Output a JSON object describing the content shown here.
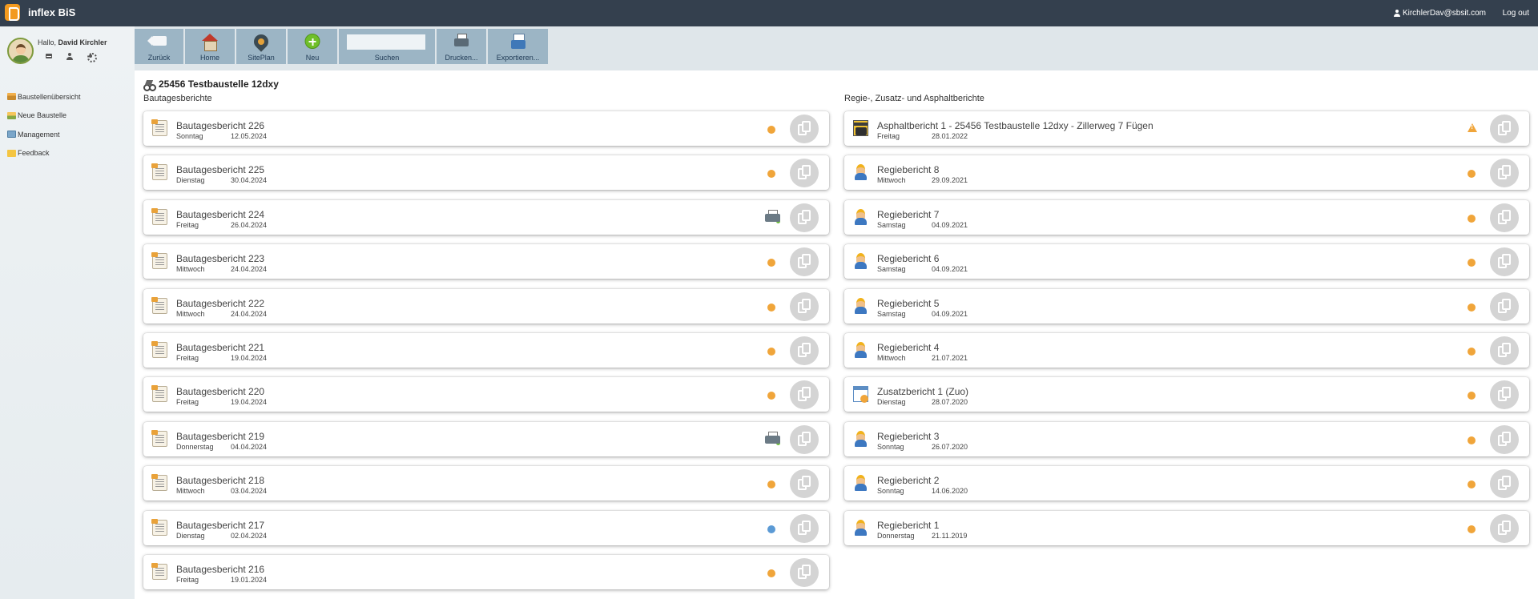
{
  "app": {
    "name": "inflex BiS",
    "user_email": "KirchlerDav@sbsit.com",
    "logout": "Log out"
  },
  "sidebar": {
    "hello_prefix": "Hallo, ",
    "user_name": "David Kirchler",
    "icons": [
      "mail-icon",
      "user-icon",
      "gear-icon"
    ],
    "items": [
      {
        "label": "Baustellenübersicht",
        "icon": "site-overview-icon"
      },
      {
        "label": "Neue Baustelle",
        "icon": "new-site-icon"
      },
      {
        "label": "Management",
        "icon": "management-icon"
      },
      {
        "label": "Feedback",
        "icon": "feedback-icon"
      }
    ]
  },
  "toolbar": {
    "back": "Zurück",
    "home": "Home",
    "siteplan": "SitePlan",
    "new": "Neu",
    "search": "Suchen",
    "search_value": "",
    "print": "Drucken...",
    "export": "Exportieren..."
  },
  "site": {
    "title": "25456 Testbaustelle 12dxy"
  },
  "colors": {
    "status_orange": "#f0a53a",
    "status_blue": "#5b9ad5",
    "topbar": "#34404e"
  },
  "left": {
    "heading": "Bautagesberichte",
    "reports": [
      {
        "title": "Bautagesbericht 226",
        "day": "Sonntag",
        "date": "12.05.2024",
        "status": "orange"
      },
      {
        "title": "Bautagesbericht 225",
        "day": "Dienstag",
        "date": "30.04.2024",
        "status": "orange"
      },
      {
        "title": "Bautagesbericht 224",
        "day": "Freitag",
        "date": "26.04.2024",
        "status": "printed"
      },
      {
        "title": "Bautagesbericht 223",
        "day": "Mittwoch",
        "date": "24.04.2024",
        "status": "orange"
      },
      {
        "title": "Bautagesbericht 222",
        "day": "Mittwoch",
        "date": "24.04.2024",
        "status": "orange"
      },
      {
        "title": "Bautagesbericht 221",
        "day": "Freitag",
        "date": "19.04.2024",
        "status": "orange"
      },
      {
        "title": "Bautagesbericht 220",
        "day": "Freitag",
        "date": "19.04.2024",
        "status": "orange"
      },
      {
        "title": "Bautagesbericht 219",
        "day": "Donnerstag",
        "date": "04.04.2024",
        "status": "printed"
      },
      {
        "title": "Bautagesbericht 218",
        "day": "Mittwoch",
        "date": "03.04.2024",
        "status": "orange"
      },
      {
        "title": "Bautagesbericht 217",
        "day": "Dienstag",
        "date": "02.04.2024",
        "status": "blue"
      },
      {
        "title": "Bautagesbericht 216",
        "day": "Freitag",
        "date": "19.01.2024",
        "status": "orange"
      }
    ]
  },
  "right": {
    "heading": "Regie-, Zusatz- und Asphaltberichte",
    "reports": [
      {
        "title": "Asphaltbericht 1 - 25456 Testbaustelle 12dxy - Zillerweg 7 Fügen",
        "day": "Freitag",
        "date": "28.01.2022",
        "status": "warning",
        "kind": "asphalt"
      },
      {
        "title": "Regiebericht 8",
        "day": "Mittwoch",
        "date": "29.09.2021",
        "status": "orange",
        "kind": "regie"
      },
      {
        "title": "Regiebericht 7",
        "day": "Samstag",
        "date": "04.09.2021",
        "status": "orange",
        "kind": "regie"
      },
      {
        "title": "Regiebericht 6",
        "day": "Samstag",
        "date": "04.09.2021",
        "status": "orange",
        "kind": "regie"
      },
      {
        "title": "Regiebericht 5",
        "day": "Samstag",
        "date": "04.09.2021",
        "status": "orange",
        "kind": "regie"
      },
      {
        "title": "Regiebericht 4",
        "day": "Mittwoch",
        "date": "21.07.2021",
        "status": "orange",
        "kind": "regie"
      },
      {
        "title": "Zusatzbericht 1 (Zuo)",
        "day": "Dienstag",
        "date": "28.07.2020",
        "status": "orange",
        "kind": "zusatz"
      },
      {
        "title": "Regiebericht 3",
        "day": "Sonntag",
        "date": "26.07.2020",
        "status": "orange",
        "kind": "regie"
      },
      {
        "title": "Regiebericht 2",
        "day": "Sonntag",
        "date": "14.06.2020",
        "status": "orange",
        "kind": "regie"
      },
      {
        "title": "Regiebericht 1",
        "day": "Donnerstag",
        "date": "21.11.2019",
        "status": "orange",
        "kind": "regie"
      }
    ]
  }
}
